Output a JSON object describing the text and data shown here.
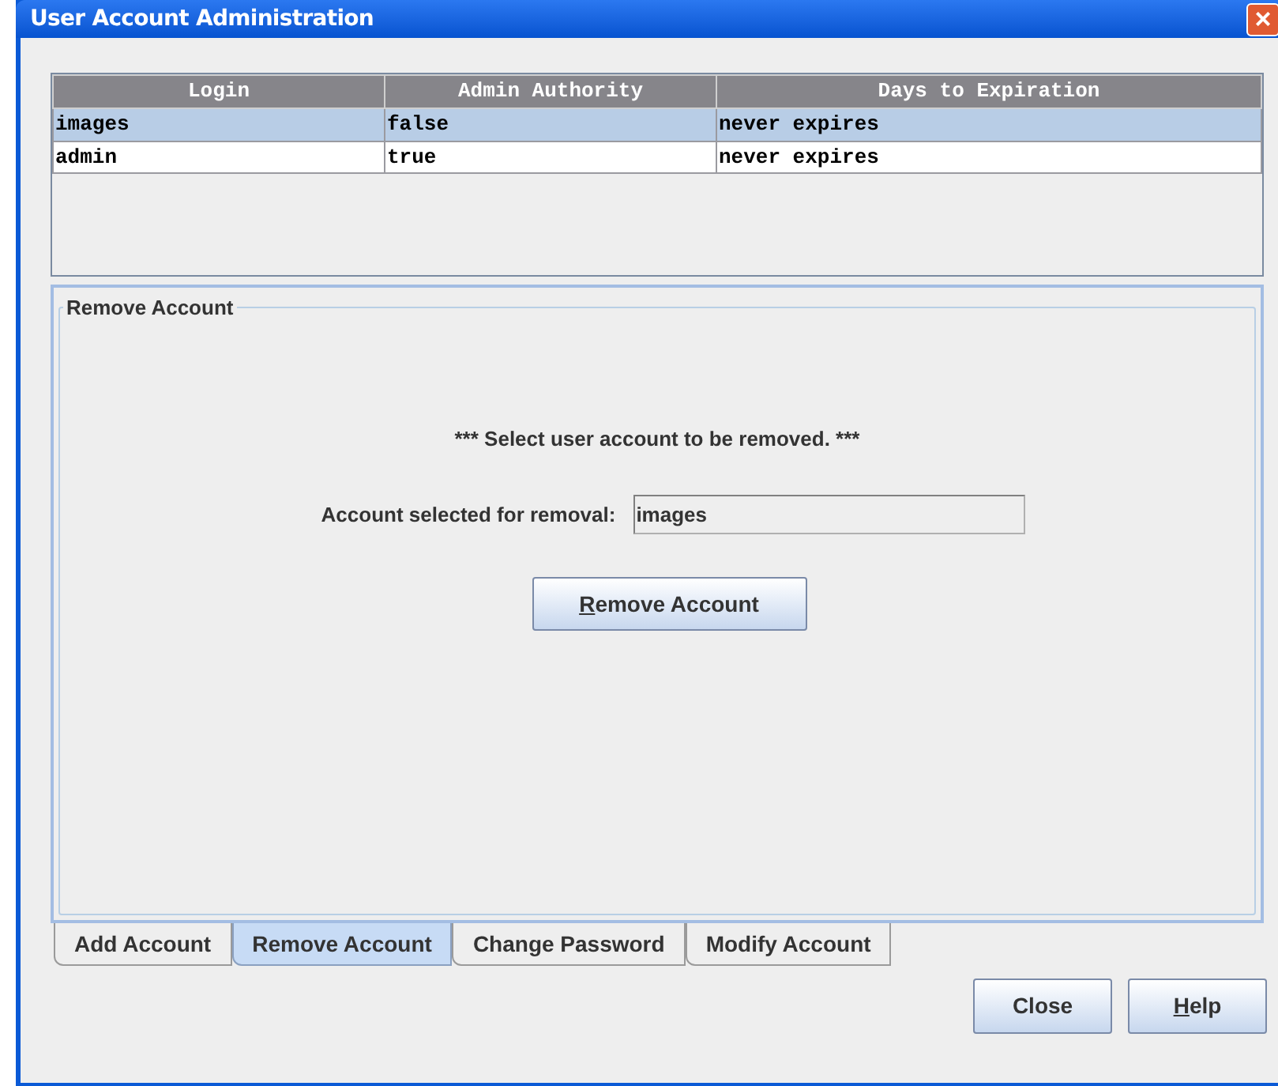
{
  "window": {
    "title": "User Account Administration",
    "close_icon": "×"
  },
  "table": {
    "columns": [
      "Login",
      "Admin Authority",
      "Days to Expiration"
    ],
    "rows": [
      {
        "cells": [
          "images",
          "false",
          "never expires"
        ],
        "selected": true
      },
      {
        "cells": [
          "admin",
          "true",
          "never expires"
        ],
        "selected": false
      }
    ]
  },
  "panel": {
    "title": "Remove Account",
    "instruction": "*** Select user account to be removed. ***",
    "field_label": "Account selected for removal:",
    "field_value": "images",
    "button": {
      "label": "Remove Account",
      "first_letter_underlined": true
    }
  },
  "tabs": [
    {
      "label": "Add Account",
      "selected": false
    },
    {
      "label": "Remove Account",
      "selected": true
    },
    {
      "label": "Change Password",
      "selected": false
    },
    {
      "label": "Modify Account",
      "selected": false
    }
  ],
  "buttons": [
    {
      "label": "Close",
      "first_letter_underlined": false
    },
    {
      "label": "Help",
      "first_letter_underlined": true
    }
  ]
}
